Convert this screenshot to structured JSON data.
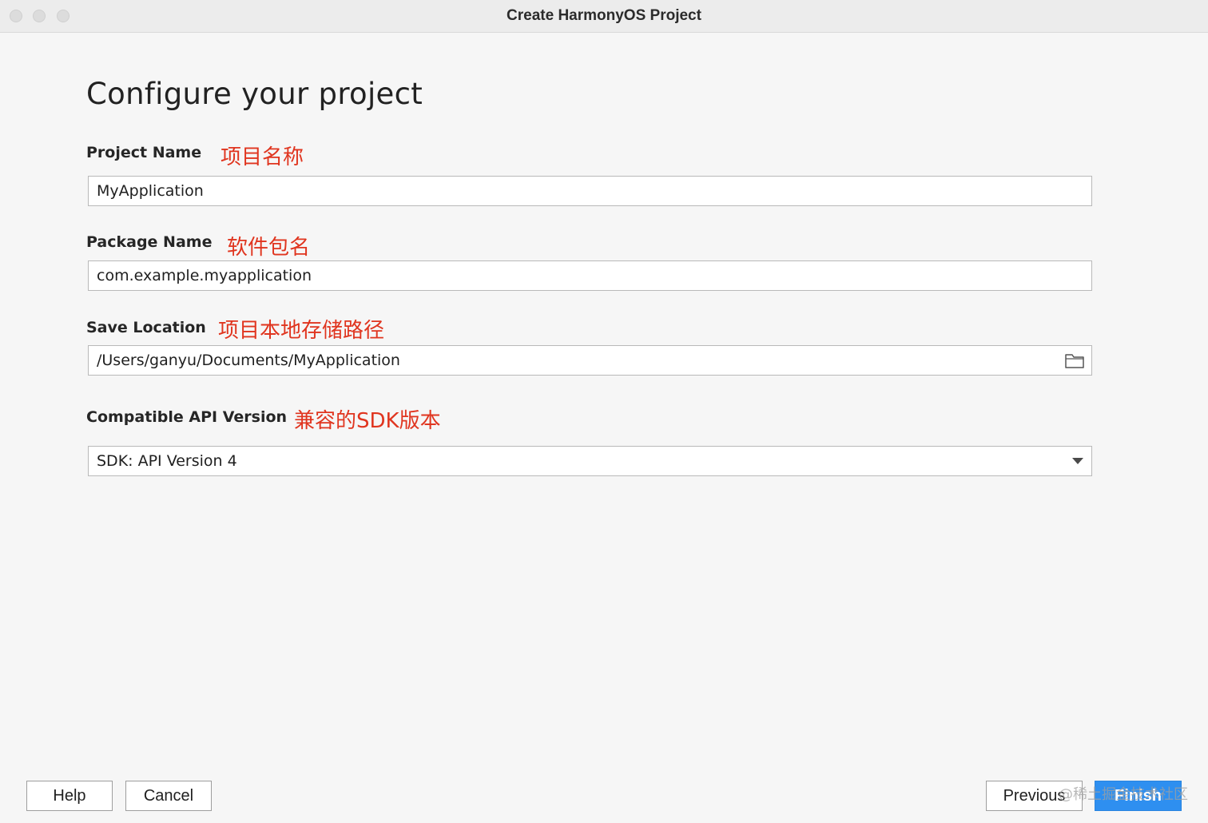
{
  "window": {
    "title": "Create HarmonyOS Project"
  },
  "page": {
    "heading": "Configure your project"
  },
  "fields": {
    "project_name": {
      "label": "Project Name",
      "annotation": "项目名称",
      "value": "MyApplication"
    },
    "package_name": {
      "label": "Package Name",
      "annotation": "软件包名",
      "value": "com.example.myapplication"
    },
    "save_location": {
      "label": "Save Location",
      "annotation": "项目本地存储路径",
      "value": "/Users/ganyu/Documents/MyApplication",
      "browse_icon": "folder-icon"
    },
    "api_version": {
      "label": "Compatible API Version",
      "annotation": "兼容的SDK版本",
      "selected": "SDK: API Version 4",
      "dropdown_icon": "chevron-down-icon"
    }
  },
  "buttons": {
    "help": "Help",
    "cancel": "Cancel",
    "previous": "Previous",
    "finish": "Finish"
  },
  "watermark": "@稀土掘金技术社区",
  "colors": {
    "annotation": "#e0351f",
    "primary_button": "#2e8ff0",
    "background": "#f6f6f6"
  }
}
